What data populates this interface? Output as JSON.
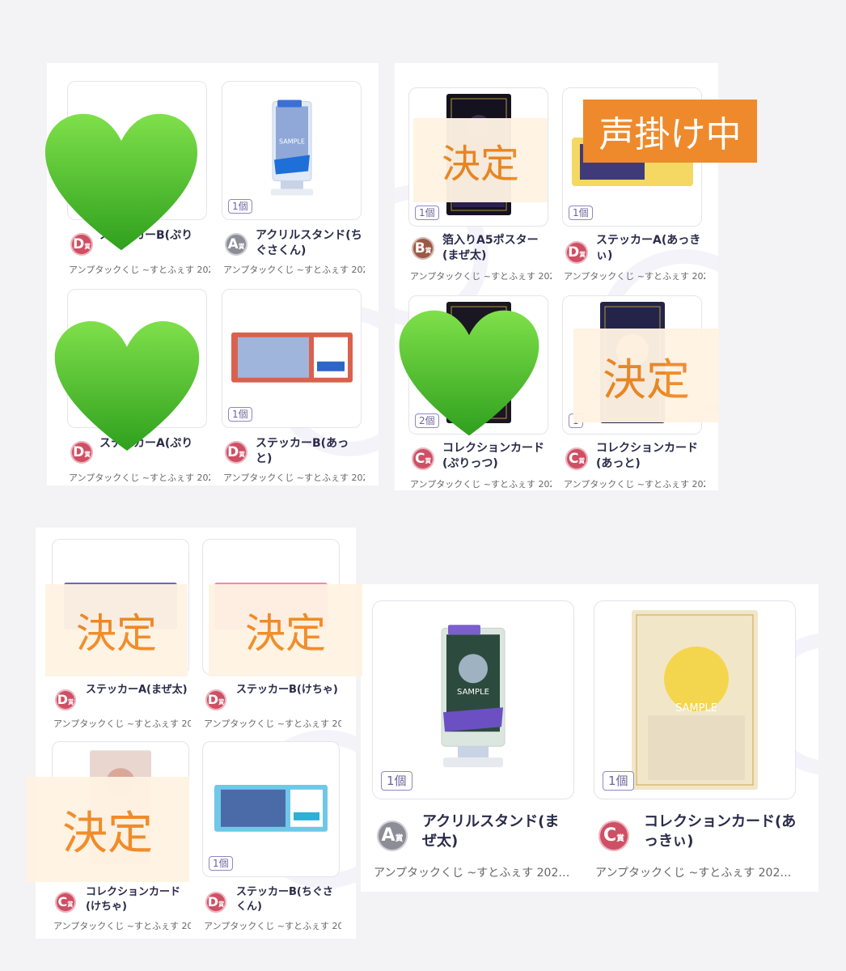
{
  "items": [
    {
      "count": "",
      "rank": "D",
      "name": "ステッカーB(ぷり",
      "sub": "アンプタックくじ ~すとふぇす 202…"
    },
    {
      "count": "1個",
      "rank": "A",
      "name": "アクリルスタンド(ちぐさくん)",
      "sub": "アンプタックくじ ~すとふぇす 202…"
    },
    {
      "count": "1個",
      "rank": "B",
      "name": "箔入りA5ポスター(まぜ太)",
      "sub": "アンプタックくじ ~すとふぇす 202…"
    },
    {
      "count": "1個",
      "rank": "D",
      "name": "ステッカーA(あっきぃ)",
      "sub": "アンプタックくじ ~すとふぇす 202…"
    },
    {
      "count": "",
      "rank": "D",
      "name": "ステッカーA(ぷり",
      "sub": "アンプタックくじ ~すとふぇす 202…"
    },
    {
      "count": "1個",
      "rank": "D",
      "name": "ステッカーB(あっと)",
      "sub": "アンプタックくじ ~すとふぇす 202…"
    },
    {
      "count": "2個",
      "rank": "C",
      "name": "コレクションカード(ぷりっつ)",
      "sub": "アンプタックくじ ~すとふぇす 202…"
    },
    {
      "count": "1",
      "rank": "C",
      "name": "コレクションカード(あっと)",
      "sub": "アンプタックくじ ~すとふぇす 202…"
    },
    {
      "count": "",
      "rank": "D",
      "name": "ステッカーA(まぜ太)",
      "sub": "アンプタックくじ ~すとふぇす 202…"
    },
    {
      "count": "",
      "rank": "D",
      "name": "ステッカーB(けちゃ)",
      "sub": "アンプタックくじ ~すとふぇす 202…"
    },
    {
      "count": "",
      "rank": "C",
      "name": "コレクションカード(けちゃ)",
      "sub": "アンプタックくじ ~すとふぇす 202…"
    },
    {
      "count": "1個",
      "rank": "D",
      "name": "ステッカーB(ちぐさくん)",
      "sub": "アンプタックくじ ~すとふぇす 202…"
    },
    {
      "count": "1個",
      "rank": "A",
      "name": "アクリルスタンド(まぜ太)",
      "sub": "アンプタックくじ ~すとふぇす 202…"
    },
    {
      "count": "1個",
      "rank": "C",
      "name": "コレクションカード(あっきぃ)",
      "sub": "アンプタックくじ ~すとふぇす 202…"
    }
  ],
  "rank_suffix": "賞",
  "overlays": {
    "decided": "決定",
    "calling": "声掛け中"
  },
  "heart_icon": "green-heart-emoji",
  "colors": {
    "rank_A": "#8d8d97",
    "rank_B": "#9a5a46",
    "rank_C": "#cf4f64",
    "rank_D": "#cf4f64",
    "decided_bg": "#fff3e3",
    "decided_text": "#f08a24",
    "calling_bg": "#ee8a2b",
    "heart": "#4cc22e"
  }
}
